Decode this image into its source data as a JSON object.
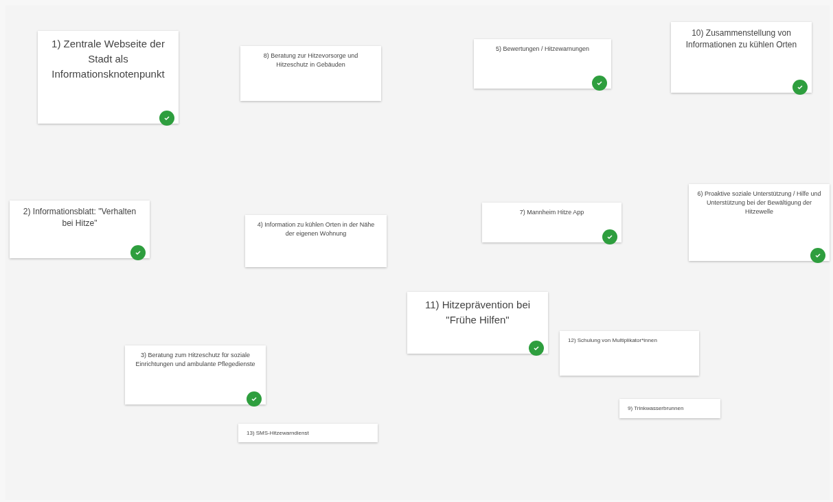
{
  "cards": [
    {
      "text": "1) Zentrale Webseite der Stadt als Informationsknotenpunkt",
      "checked": true
    },
    {
      "text": "8) Beratung zur Hitzevorsorge und Hitzeschutz in Gebäuden",
      "checked": false
    },
    {
      "text": "5) Bewertungen / Hitzewarnungen",
      "checked": true
    },
    {
      "text": "10) Zusammenstellung von Informationen zu kühlen Orten",
      "checked": true
    },
    {
      "text": "2) Informationsblatt: \"Verhalten bei Hitze\"",
      "checked": true
    },
    {
      "text": "4) Information zu kühlen Orten in der Nähe der eigenen Wohnung",
      "checked": false
    },
    {
      "text": "7) Mannheim Hitze App",
      "checked": true
    },
    {
      "text": "6) Proaktive soziale Unterstützung / Hilfe und Unterstützung bei der Bewältigung der Hitzewelle",
      "checked": true
    },
    {
      "text": "11) Hitzeprävention bei \"Frühe Hilfen\"",
      "checked": true
    },
    {
      "text": "3) Beratung zum Hitzeschutz für soziale Einrichtungen und ambulante Pflegedienste",
      "checked": true
    },
    {
      "text": "12) Schulung von Multiplikator*innen",
      "checked": false
    },
    {
      "text": "9) Trinkwasserbrunnen",
      "checked": false
    },
    {
      "text": "13) SMS-Hitzewarndienst",
      "checked": false
    }
  ]
}
